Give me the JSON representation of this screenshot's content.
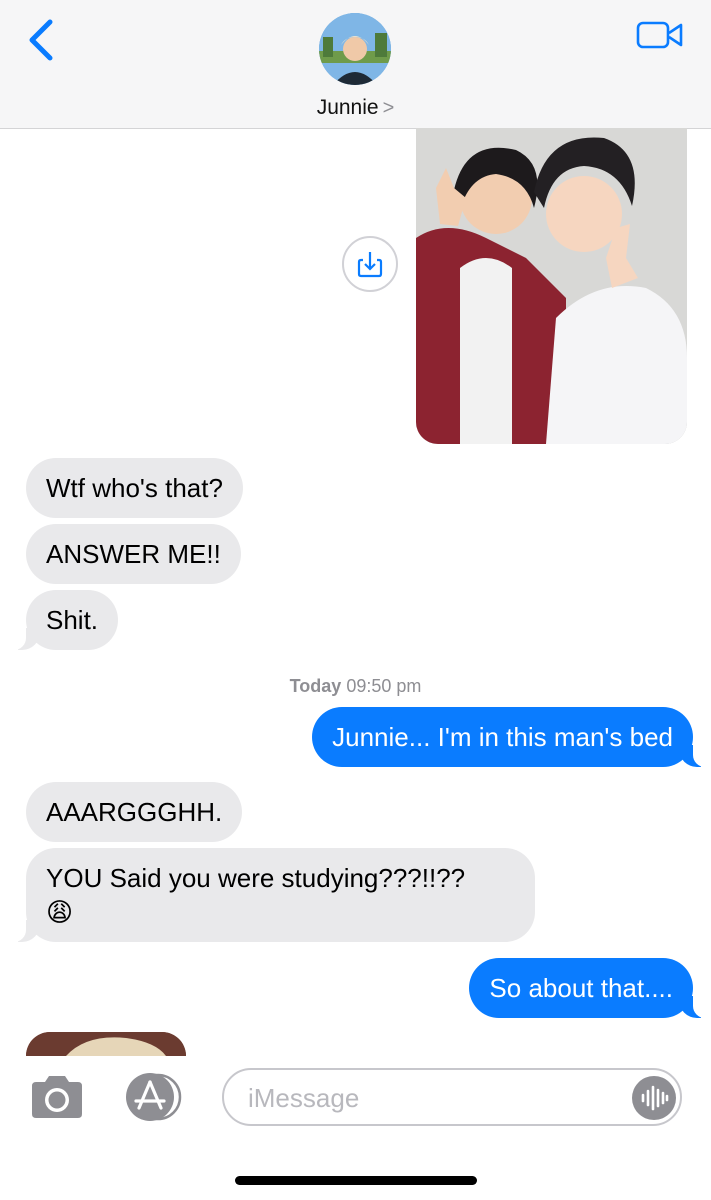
{
  "header": {
    "contact_name": "Junnie",
    "chevron": ">",
    "icons": {
      "back": "back-chevron-icon",
      "video": "video-camera-icon",
      "avatar": "contact-avatar"
    },
    "accent_color": "#0a7cff"
  },
  "messages": [
    {
      "type": "image",
      "direction": "outgoing",
      "description_icon": "photo-attachment"
    },
    {
      "type": "text",
      "direction": "incoming",
      "text": "Wtf who's that?"
    },
    {
      "type": "text",
      "direction": "incoming",
      "text": "ANSWER ME!!"
    },
    {
      "type": "text",
      "direction": "incoming",
      "text": "Shit."
    },
    {
      "type": "text",
      "direction": "outgoing",
      "text": "Junnie... I'm in this man's bed"
    },
    {
      "type": "text",
      "direction": "incoming",
      "text": "AAARGGGHH."
    },
    {
      "type": "text",
      "direction": "incoming",
      "text": "YOU Said you were studying???!!??",
      "emoji": "😩"
    },
    {
      "type": "text",
      "direction": "outgoing",
      "text": "So about that...."
    }
  ],
  "timestamp": {
    "day": "Today",
    "time": "09:50 pm"
  },
  "input_bar": {
    "placeholder": "iMessage",
    "icons": {
      "camera": "camera-icon",
      "apps": "app-store-icon",
      "audio": "audio-waveform-icon",
      "save": "save-download-icon"
    }
  },
  "colors": {
    "incoming_bubble": "#e9e9eb",
    "outgoing_bubble": "#0a7cff",
    "header_bg": "#f6f6f7"
  }
}
